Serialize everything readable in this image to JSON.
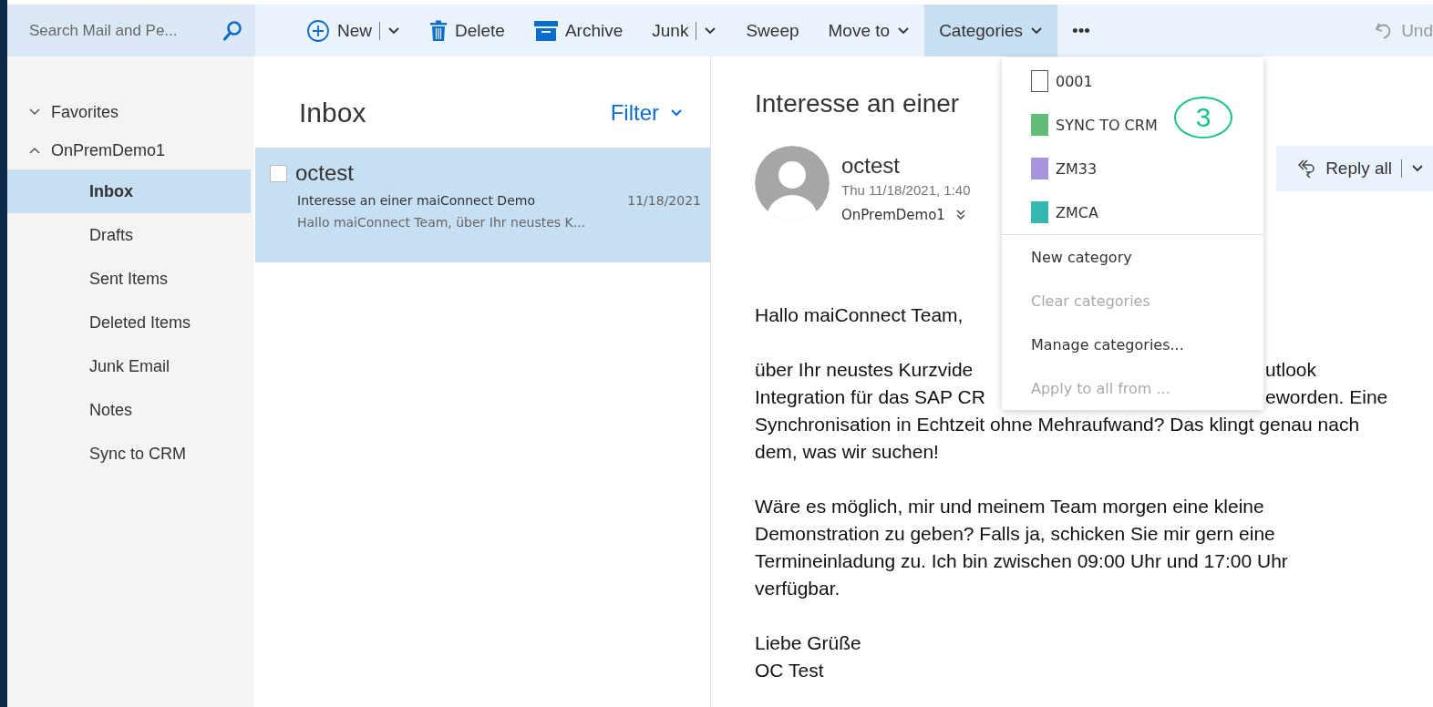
{
  "search": {
    "placeholder": "Search Mail and Pe..."
  },
  "toolbar": [
    {
      "label": "New",
      "kind": "split",
      "selected": false,
      "disabled": false
    },
    {
      "label": "Delete",
      "kind": "plain",
      "selected": false,
      "disabled": false
    },
    {
      "label": "Archive",
      "kind": "plain",
      "selected": false,
      "disabled": false
    },
    {
      "label": "Junk",
      "kind": "split",
      "selected": false,
      "disabled": false
    },
    {
      "label": "Sweep",
      "kind": "plain",
      "selected": false,
      "disabled": false
    },
    {
      "label": "Move to",
      "kind": "menu",
      "selected": false,
      "disabled": false
    },
    {
      "label": "Categories",
      "kind": "menu",
      "selected": true,
      "disabled": false
    },
    {
      "label": "•••",
      "kind": "more",
      "selected": false,
      "disabled": false
    },
    {
      "label": "Und",
      "kind": "undo",
      "selected": false,
      "disabled": true
    }
  ],
  "sidebar": {
    "items": [
      {
        "label": "Favorites",
        "expanded": false,
        "selected": false
      },
      {
        "label": "OnPremDemo1",
        "expanded": true,
        "selected": false,
        "children": [
          {
            "label": "Inbox",
            "selected": true
          },
          {
            "label": "Drafts",
            "selected": false
          },
          {
            "label": "Sent Items",
            "selected": false
          },
          {
            "label": "Deleted Items",
            "selected": false
          },
          {
            "label": "Junk Email",
            "selected": false
          },
          {
            "label": "Notes",
            "selected": false
          },
          {
            "label": "Sync to CRM",
            "selected": false
          }
        ]
      }
    ]
  },
  "message_list": {
    "title": "Inbox",
    "filter": "Filter",
    "messages": [
      {
        "sender": "octest",
        "subject": "Interesse an einer maiConnect Demo",
        "date": "11/18/2021",
        "preview": "Hallo maiConnect Team,   über Ihr neustes K...",
        "selected": true,
        "checked": false
      }
    ]
  },
  "reading_pane": {
    "subject": "Interesse an einer",
    "sender": "octest",
    "date": "Thu 11/18/2021, 1:40",
    "mailbox": "OnPremDemo1",
    "reply_all": "Reply all",
    "body": [
      {
        "kind": "line",
        "text": "Hallo maiConnect Team,"
      },
      {
        "kind": "gap"
      },
      {
        "kind": "split",
        "left": "über Ihr neustes Kurzvide",
        "right": "utlook"
      },
      {
        "kind": "split",
        "left": "Integration für das SAP CR",
        "right": "eworden. Eine"
      },
      {
        "kind": "line",
        "text": "Synchronisation in Echtzeit ohne Mehraufwand? Das klingt genau nach"
      },
      {
        "kind": "line",
        "text": "dem, was wir suchen!"
      },
      {
        "kind": "gap"
      },
      {
        "kind": "line",
        "text": "Wäre es möglich, mir und meinem Team morgen eine kleine"
      },
      {
        "kind": "line",
        "text": "Demonstration zu geben? Falls ja, schicken Sie mir gern eine"
      },
      {
        "kind": "line",
        "text": "Termineinladung zu. Ich bin zwischen 09:00 Uhr und 17:00 Uhr"
      },
      {
        "kind": "line",
        "text": "verfügbar."
      },
      {
        "kind": "gap"
      },
      {
        "kind": "line",
        "text": "Liebe Grüße"
      },
      {
        "kind": "line",
        "text": "OC Test"
      }
    ]
  },
  "categories_menu": {
    "categories": [
      {
        "name": "0001",
        "color": "#ffffff"
      },
      {
        "name": "SYNC TO CRM",
        "color": "#63bb79"
      },
      {
        "name": "ZM33",
        "color": "#a794dd"
      },
      {
        "name": "ZMCA",
        "color": "#35b8b0"
      }
    ],
    "actions": [
      {
        "label": "New category",
        "disabled": false
      },
      {
        "label": "Clear categories",
        "disabled": true
      },
      {
        "label": "Manage categories...",
        "disabled": false
      },
      {
        "label": "Apply to all from ...",
        "disabled": true
      }
    ]
  },
  "annotation": {
    "text": "3"
  }
}
